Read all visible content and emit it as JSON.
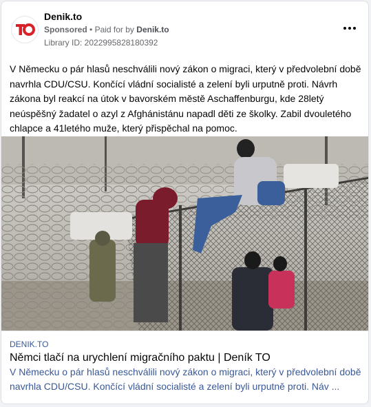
{
  "page": {
    "name": "Denik.to"
  },
  "meta": {
    "sponsored": "Sponsored",
    "separator": "•",
    "paid_for_by_label": "Paid for by",
    "paid_for_by": "Denik.to",
    "library_id": "Library ID: 2022995828180392"
  },
  "post": {
    "text": "V Německu o pár hlasů neschválili nový zákon o migraci, který v předvolební době navrhla CDU/CSU. Končící vládní socialisté a zelení byli urputně proti. Návrh zákona byl reakcí na útok v bavorském městě Aschaffenburgu, kde 28letý neúspěšný žadatel o azyl z Afghánistánu napadl děti ze školky. Zabil dvouletého chlapce a 41letého muže, který přispěchal na pomoc."
  },
  "link": {
    "domain": "DENIK.TO",
    "title": "Němci tlačí na urychlení migračního paktu | Deník TO",
    "description": "V Německu o pár hlasů neschválili nový zákon o migraci, který v předvolební době navrhla CDU/CSU. Končící vládní socialisté a zelení byli urputně proti. Náv ..."
  },
  "icons": {
    "more": "more-options-icon",
    "logo": "denik-to-logo"
  },
  "colors": {
    "brand_red": "#d9212a",
    "link_blue": "#385898",
    "meta_gray": "#65676b"
  }
}
